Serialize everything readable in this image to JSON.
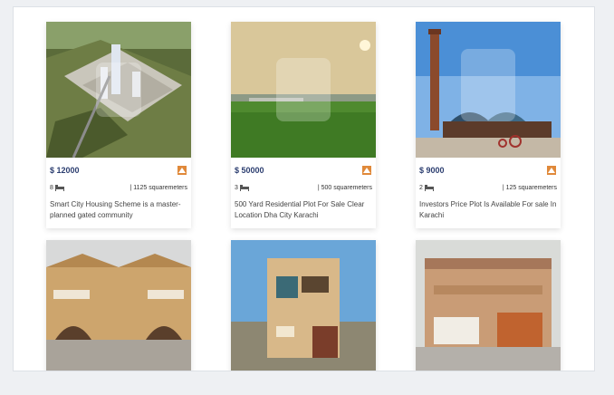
{
  "listings": [
    {
      "price": "$ 12000",
      "beds": "8",
      "area": "| 1125 squaremeters",
      "title": "Smart City Housing Scheme is a master-planned gated community",
      "image": "aerial-city-render"
    },
    {
      "price": "$ 50000",
      "beds": "3",
      "area": "| 500 squaremeters",
      "title": "500 Yard Residential Plot For Sale Clear Location Dha City Karachi",
      "image": "open-plot-sunset"
    },
    {
      "price": "$ 9000",
      "beds": "2",
      "area": "| 125 squaremeters",
      "title": "Investors Price Plot Is Available For sale In Karachi",
      "image": "mosque-minaret-gate"
    },
    {
      "image": "beige-townhouses"
    },
    {
      "image": "modern-villa"
    },
    {
      "image": "brick-bungalow"
    }
  ],
  "colors": {
    "price": "#2c3e70",
    "brand": "#e0893a",
    "panel_bg": "#ffffff",
    "page_bg": "#eef0f3"
  },
  "icons": {
    "bed": "bed-icon",
    "brand": "agency-logo-icon",
    "watermark": "watermark-logo"
  }
}
